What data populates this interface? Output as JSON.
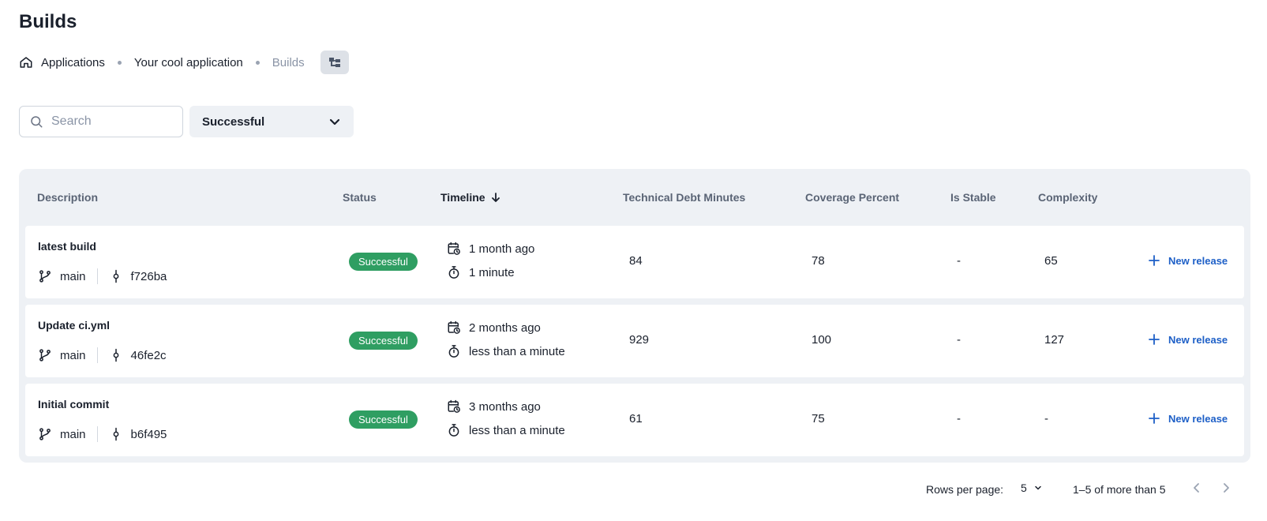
{
  "page": {
    "title": "Builds"
  },
  "breadcrumb": {
    "items": [
      "Applications",
      "Your cool application",
      "Builds"
    ]
  },
  "filters": {
    "search_placeholder": "Search",
    "search_value": "",
    "status_value": "Successful"
  },
  "table": {
    "columns": {
      "description": "Description",
      "status": "Status",
      "timeline": "Timeline",
      "debt": "Technical Debt Minutes",
      "coverage": "Coverage Percent",
      "stable": "Is Stable",
      "complexity": "Complexity"
    },
    "rows": [
      {
        "title": "latest build",
        "branch": "main",
        "commit": "f726ba",
        "status": "Successful",
        "started": "1 month ago",
        "duration": "1 minute",
        "debt": "84",
        "coverage": "78",
        "stable": "-",
        "complexity": "65",
        "action": "New release"
      },
      {
        "title": "Update ci.yml",
        "branch": "main",
        "commit": "46fe2c",
        "status": "Successful",
        "started": "2 months ago",
        "duration": "less than a minute",
        "debt": "929",
        "coverage": "100",
        "stable": "-",
        "complexity": "127",
        "action": "New release"
      },
      {
        "title": "Initial commit",
        "branch": "main",
        "commit": "b6f495",
        "status": "Successful",
        "started": "3 months ago",
        "duration": "less than a minute",
        "debt": "61",
        "coverage": "75",
        "stable": "-",
        "complexity": "-",
        "action": "New release"
      }
    ]
  },
  "pagination": {
    "rows_per_page_label": "Rows per page:",
    "rows_per_page": "5",
    "range": "1–5 of more than 5"
  },
  "colors": {
    "success": "#2f9e62",
    "link": "#1d5fc7",
    "surface": "#eef1f5"
  },
  "icons": [
    "home-icon",
    "tree-icon",
    "search-icon",
    "chevron-down-icon",
    "arrow-down-icon",
    "git-branch-icon",
    "git-commit-icon",
    "calendar-clock-icon",
    "stopwatch-icon",
    "plus-icon",
    "chevron-left-icon",
    "chevron-right-icon"
  ]
}
